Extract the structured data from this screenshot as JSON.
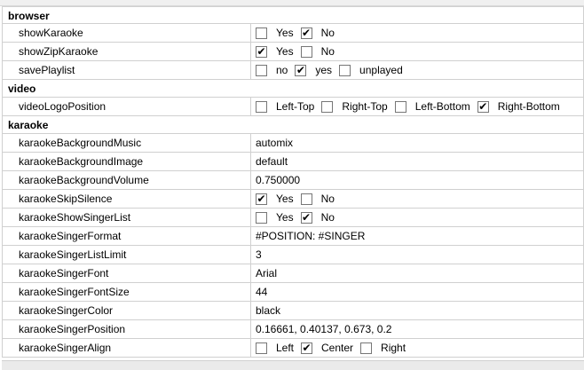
{
  "sections": [
    {
      "title": "browser",
      "rows": [
        {
          "key": "showKaraoke",
          "type": "options",
          "options": [
            {
              "label": "Yes",
              "checked": false
            },
            {
              "label": "No",
              "checked": true
            }
          ]
        },
        {
          "key": "showZipKaraoke",
          "type": "options",
          "options": [
            {
              "label": "Yes",
              "checked": true
            },
            {
              "label": "No",
              "checked": false
            }
          ]
        },
        {
          "key": "savePlaylist",
          "type": "options",
          "options": [
            {
              "label": "no",
              "checked": false
            },
            {
              "label": "yes",
              "checked": true
            },
            {
              "label": "unplayed",
              "checked": false
            }
          ]
        }
      ]
    },
    {
      "title": "video",
      "rows": [
        {
          "key": "videoLogoPosition",
          "type": "options",
          "options": [
            {
              "label": "Left-Top",
              "checked": false
            },
            {
              "label": "Right-Top",
              "checked": false
            },
            {
              "label": "Left-Bottom",
              "checked": false
            },
            {
              "label": "Right-Bottom",
              "checked": true
            }
          ]
        }
      ]
    },
    {
      "title": "karaoke",
      "rows": [
        {
          "key": "karaokeBackgroundMusic",
          "type": "text",
          "value": "automix"
        },
        {
          "key": "karaokeBackgroundImage",
          "type": "text",
          "value": "default"
        },
        {
          "key": "karaokeBackgroundVolume",
          "type": "text",
          "value": "0.750000"
        },
        {
          "key": "karaokeSkipSilence",
          "type": "options",
          "options": [
            {
              "label": "Yes",
              "checked": true
            },
            {
              "label": "No",
              "checked": false
            }
          ]
        },
        {
          "key": "karaokeShowSingerList",
          "type": "options",
          "options": [
            {
              "label": "Yes",
              "checked": false
            },
            {
              "label": "No",
              "checked": true
            }
          ]
        },
        {
          "key": "karaokeSingerFormat",
          "type": "text",
          "value": "#POSITION: #SINGER"
        },
        {
          "key": "karaokeSingerListLimit",
          "type": "text",
          "value": "3"
        },
        {
          "key": "karaokeSingerFont",
          "type": "text",
          "value": "Arial"
        },
        {
          "key": "karaokeSingerFontSize",
          "type": "text",
          "value": "44"
        },
        {
          "key": "karaokeSingerColor",
          "type": "text",
          "value": "black"
        },
        {
          "key": "karaokeSingerPosition",
          "type": "text",
          "value": "0.16661, 0.40137, 0.673, 0.2"
        },
        {
          "key": "karaokeSingerAlign",
          "type": "options",
          "options": [
            {
              "label": "Left",
              "checked": false
            },
            {
              "label": "Center",
              "checked": true
            },
            {
              "label": "Right",
              "checked": false
            }
          ]
        }
      ]
    }
  ]
}
